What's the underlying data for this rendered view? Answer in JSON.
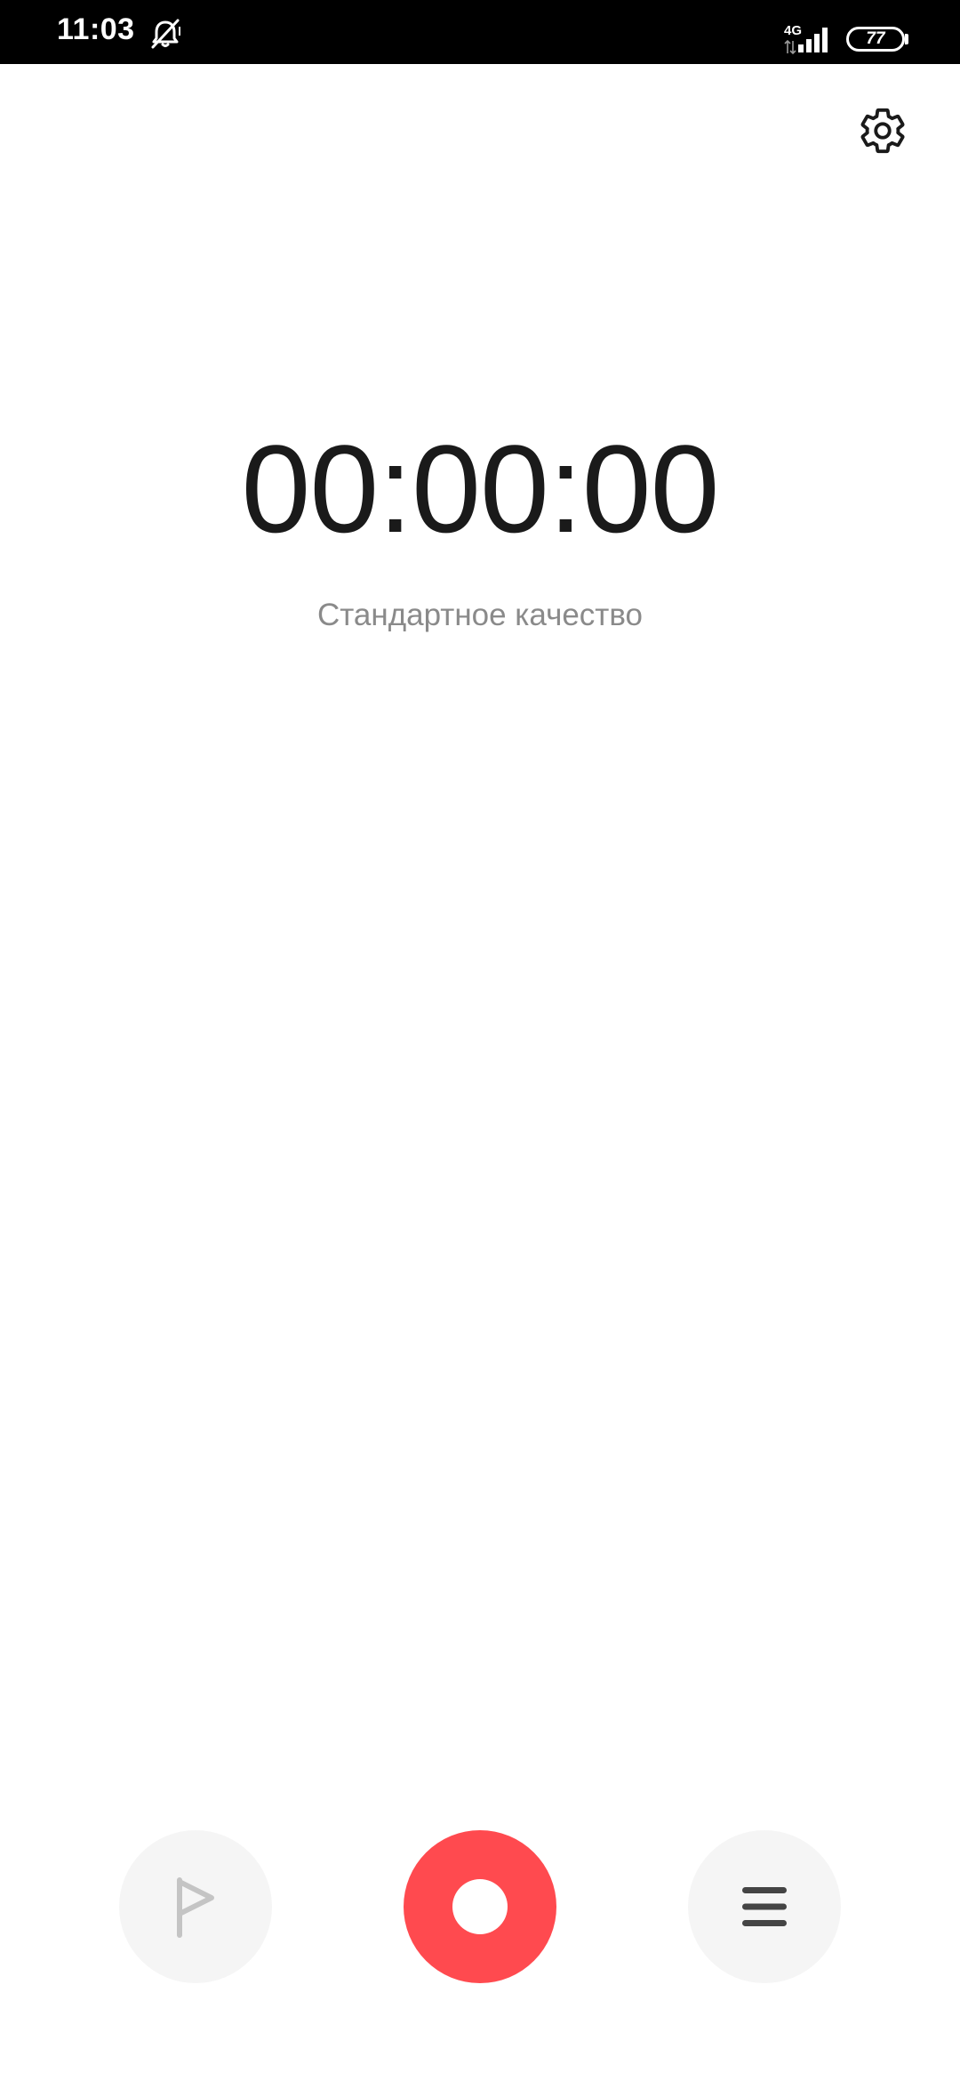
{
  "status_bar": {
    "time": "11:03",
    "network": "4G",
    "battery": "77",
    "icons": [
      "mute-icon",
      "data-arrows-icon",
      "signal-icon",
      "battery-icon"
    ]
  },
  "header": {
    "settings_icon": "gear-icon"
  },
  "recorder": {
    "timer": "00:00:00",
    "quality": "Стандартное качество"
  },
  "controls": {
    "flag_icon": "flag-icon",
    "record_icon": "record-icon",
    "list_icon": "menu-icon"
  },
  "colors": {
    "record_accent": "#ff4a4f",
    "control_bg": "#f5f5f5",
    "timer_text": "#1a1a1a",
    "secondary_text": "#8a8a8a"
  }
}
